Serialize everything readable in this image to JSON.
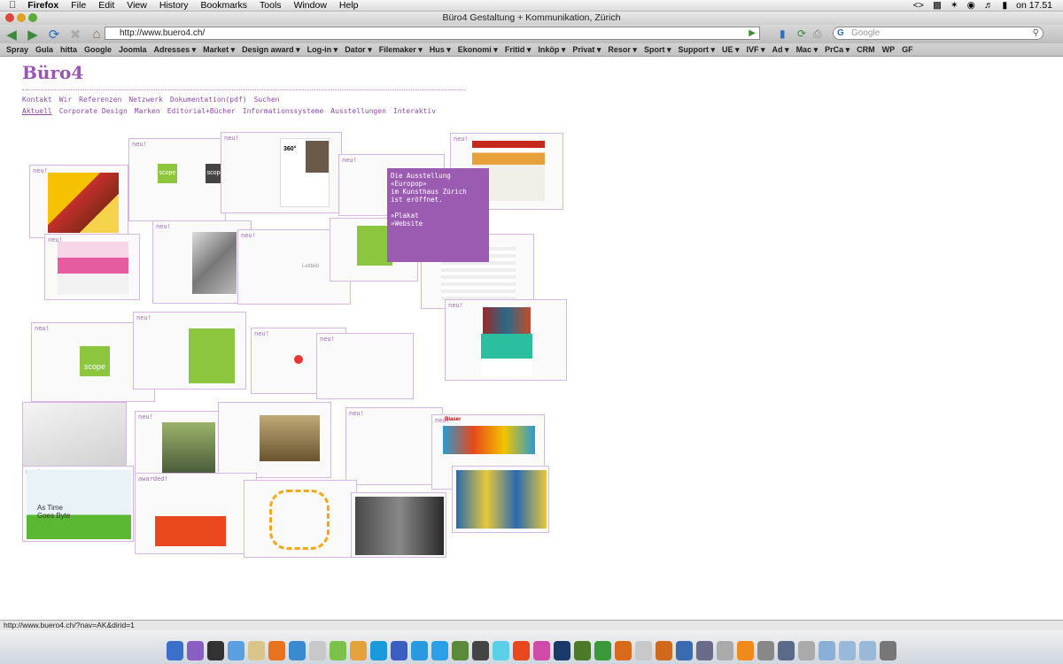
{
  "menubar": {
    "app": "Firefox",
    "items": [
      "File",
      "Edit",
      "View",
      "History",
      "Bookmarks",
      "Tools",
      "Window",
      "Help"
    ],
    "clock": "on 17.51"
  },
  "window": {
    "title": "Büro4 Gestaltung + Kommunikation, Zürich"
  },
  "navbar": {
    "url": "http://www.buero4.ch/",
    "search_placeholder": "Google"
  },
  "bookmarks": [
    "Spray",
    "Gula",
    "hitta",
    "Google",
    "Joomla",
    "Adresses ▾",
    "Market ▾",
    "Design award ▾",
    "Log-in ▾",
    "Dator ▾",
    "Filemaker ▾",
    "Hus ▾",
    "Ekonomi ▾",
    "Fritid ▾",
    "Inköp ▾",
    "Privat ▾",
    "Resor ▾",
    "Sport ▾",
    "Support ▾",
    "UE ▾",
    "IVF ▾",
    "Ad ▾",
    "Mac ▾",
    "PrCa ▾",
    "CRM",
    "WP",
    "GF"
  ],
  "site": {
    "logo": "Büro4",
    "nav_primary": [
      "Kontakt",
      "Wir",
      "Referenzen",
      "Netzwerk",
      "Dokumentation(pdf)",
      "Suchen"
    ],
    "nav_secondary": [
      "Aktuell",
      "Corporate Design",
      "Marken",
      "Editorial+Bücher",
      "Informationssysteme",
      "Ausstellungen",
      "Interaktiv"
    ],
    "popup": "Die Ausstellung\n«Europop»\nim Kunsthaus Zürich\nist eröffnet.\n\n»Plakat\n»Website",
    "label_new": "neu!",
    "label_awarded": "awarded!",
    "thumb_scope": "scope",
    "thumb_360": "360°",
    "thumb_leitbild": "Leitbild",
    "thumb_as_time": "As Time\nGoes Byte",
    "thumb_blaser": "Blaser"
  },
  "status": {
    "text": "http://www.buero4.ch/?nav=AK&dirid=1"
  },
  "colors": {
    "accent": "#9a55b4",
    "popup": "#9a5bb1",
    "green": "#8cc63f",
    "orange": "#e8481c"
  }
}
